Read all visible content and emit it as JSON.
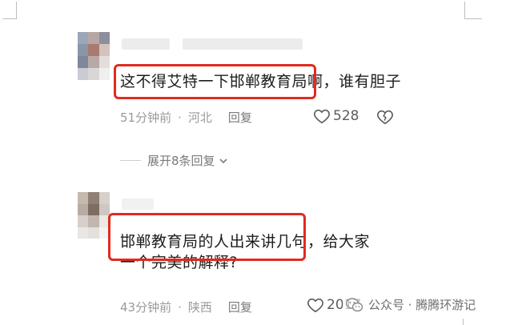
{
  "comments": [
    {
      "text": "这不得艾特一下邯郸教育局啊，谁有胆子",
      "time": "51分钟前",
      "location": "河北",
      "reply_label": "回复",
      "likes": "528",
      "expand_label": "展开8条回复"
    },
    {
      "text": "邯郸教育局的人出来讲几句，给大家一个完美的解释?",
      "time": "43分钟前",
      "location": "陕西",
      "reply_label": "回复",
      "likes": "2017"
    }
  ],
  "watermark": {
    "text": "公众号 · 腾腾环游记"
  },
  "colors": {
    "highlight": "#e02b20",
    "meta": "#9a9a9a"
  },
  "icons": [
    "heart-outline-icon",
    "broken-heart-icon",
    "chevron-down-icon",
    "wechat-logo-icon"
  ]
}
